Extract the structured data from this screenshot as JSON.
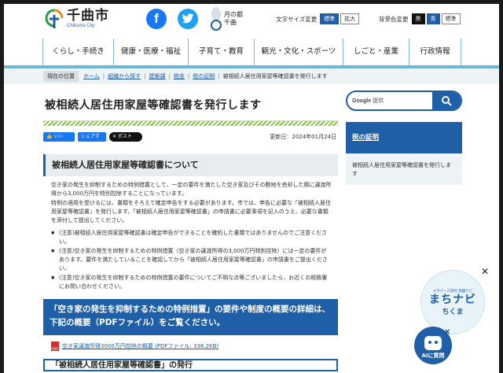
{
  "header": {
    "city_name": "千曲市",
    "city_name_en": "Chikuma City",
    "moon_line1": "月の都",
    "moon_line2": "千曲",
    "font_size_label": "文字サイズ変更",
    "font_size_standard": "標準",
    "font_size_large": "拡大",
    "bg_color_label": "背景色変更",
    "bg_black": "黒",
    "bg_blue": "青",
    "bg_standard": "標準"
  },
  "nav": {
    "items": [
      "くらし・手続き",
      "健康・医療・福祉",
      "子育て・教育",
      "観光・文化・スポーツ",
      "しごと・産業",
      "行政情報"
    ]
  },
  "breadcrumb": {
    "here": "現在の位置",
    "links": [
      "ホーム",
      "組織から探す",
      "建築課",
      "税金",
      "税の証明"
    ],
    "current": "被相続人居住用家屋等確認書を発行します"
  },
  "main": {
    "title": "被相続人居住用家屋等確認書を発行します",
    "like": "👍 いいね！",
    "share": "シェアする",
    "post": "✕ ポスト",
    "updated": "更新日：2024年01月24日",
    "section_title": "被相続人居住用家屋等確認書について",
    "para1": "空き家の発生を抑制するための特例措置として、一定の要件を満たした空き家及びその敷地を売却した際に譲渡所得から3,000万円を特別控除することになっています。",
    "para2": "特例の適用を受けるには、書類をそろえて確定申告をする必要があります。市では、申告に必要な「被相続人居住用家屋等確認書」を発行します。「被相続人居住用家屋等確認書」の申請書に必要事項を記入のうえ、必要な書類を添付して提出してください。",
    "notes": [
      "(注意)被相続人居住用家屋等確認書は確定申告ができることを確約した書類ではありませんのでご注意ください。",
      "(注意)空き家の発生を抑制するための特例措置（空き家の譲渡所得の3,000万円特別控除）には一定の要件があります。要件を満たしていることを確認してから「被相続人居住用家屋等確認書」の申請書をご提出ください。",
      "(注意)空き家の発生を抑制するための特例措置の要件についてご不明な点等ございましたら、お近くの税務署にお問い合わせください。"
    ],
    "blue_box": "「空き家の発生を抑制するための特例措置」の要件や制度の概要の詳細は、下記の概要（PDFファイル）をご覧ください。",
    "pdf_link": "空き家譲渡所得3000万円控除の概要 (PDFファイル: 336.2KB)",
    "pdf_icon_text": "PDF",
    "bottom_head": "「被相続人居住用家屋等確認書」の発行"
  },
  "sidebar": {
    "search_brand": "Google",
    "search_suffix": "提供",
    "head": "税の証明",
    "item": "被相続人居住用家屋等確認書を発行します"
  },
  "widgets": {
    "machi_small": "メタバース受付 地図ナビ",
    "machi_big": "まちナビ",
    "machi_big2": "ちくま",
    "ai_label": "AIに質問"
  },
  "colors": {
    "primary": "#1e5fa8",
    "nav_line": "#6cb7d4",
    "facebook": "#1877f2",
    "twitter": "#1da1f2"
  }
}
